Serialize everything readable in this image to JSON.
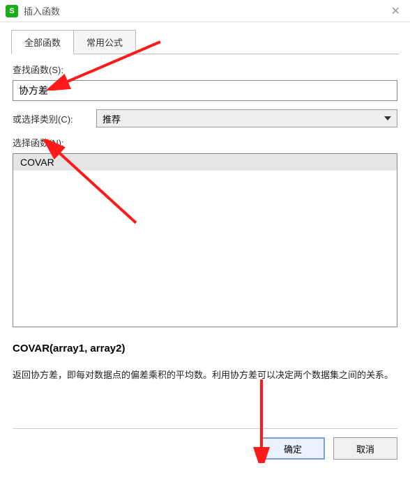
{
  "titlebar": {
    "title": "插入函数"
  },
  "tabs": {
    "all": "全部函数",
    "common": "常用公式"
  },
  "search": {
    "label": "查找函数(S):",
    "value": "协方差"
  },
  "category": {
    "label": "或选择类别(C):",
    "selected": "推荐"
  },
  "functions": {
    "label": "选择函数(N):",
    "items": [
      "COVAR"
    ]
  },
  "detail": {
    "signature": "COVAR(array1, array2)",
    "description": "返回协方差，即每对数据点的偏差乘积的平均数。利用协方差可以决定两个数据集之间的关系。"
  },
  "buttons": {
    "ok": "确定",
    "cancel": "取消"
  }
}
